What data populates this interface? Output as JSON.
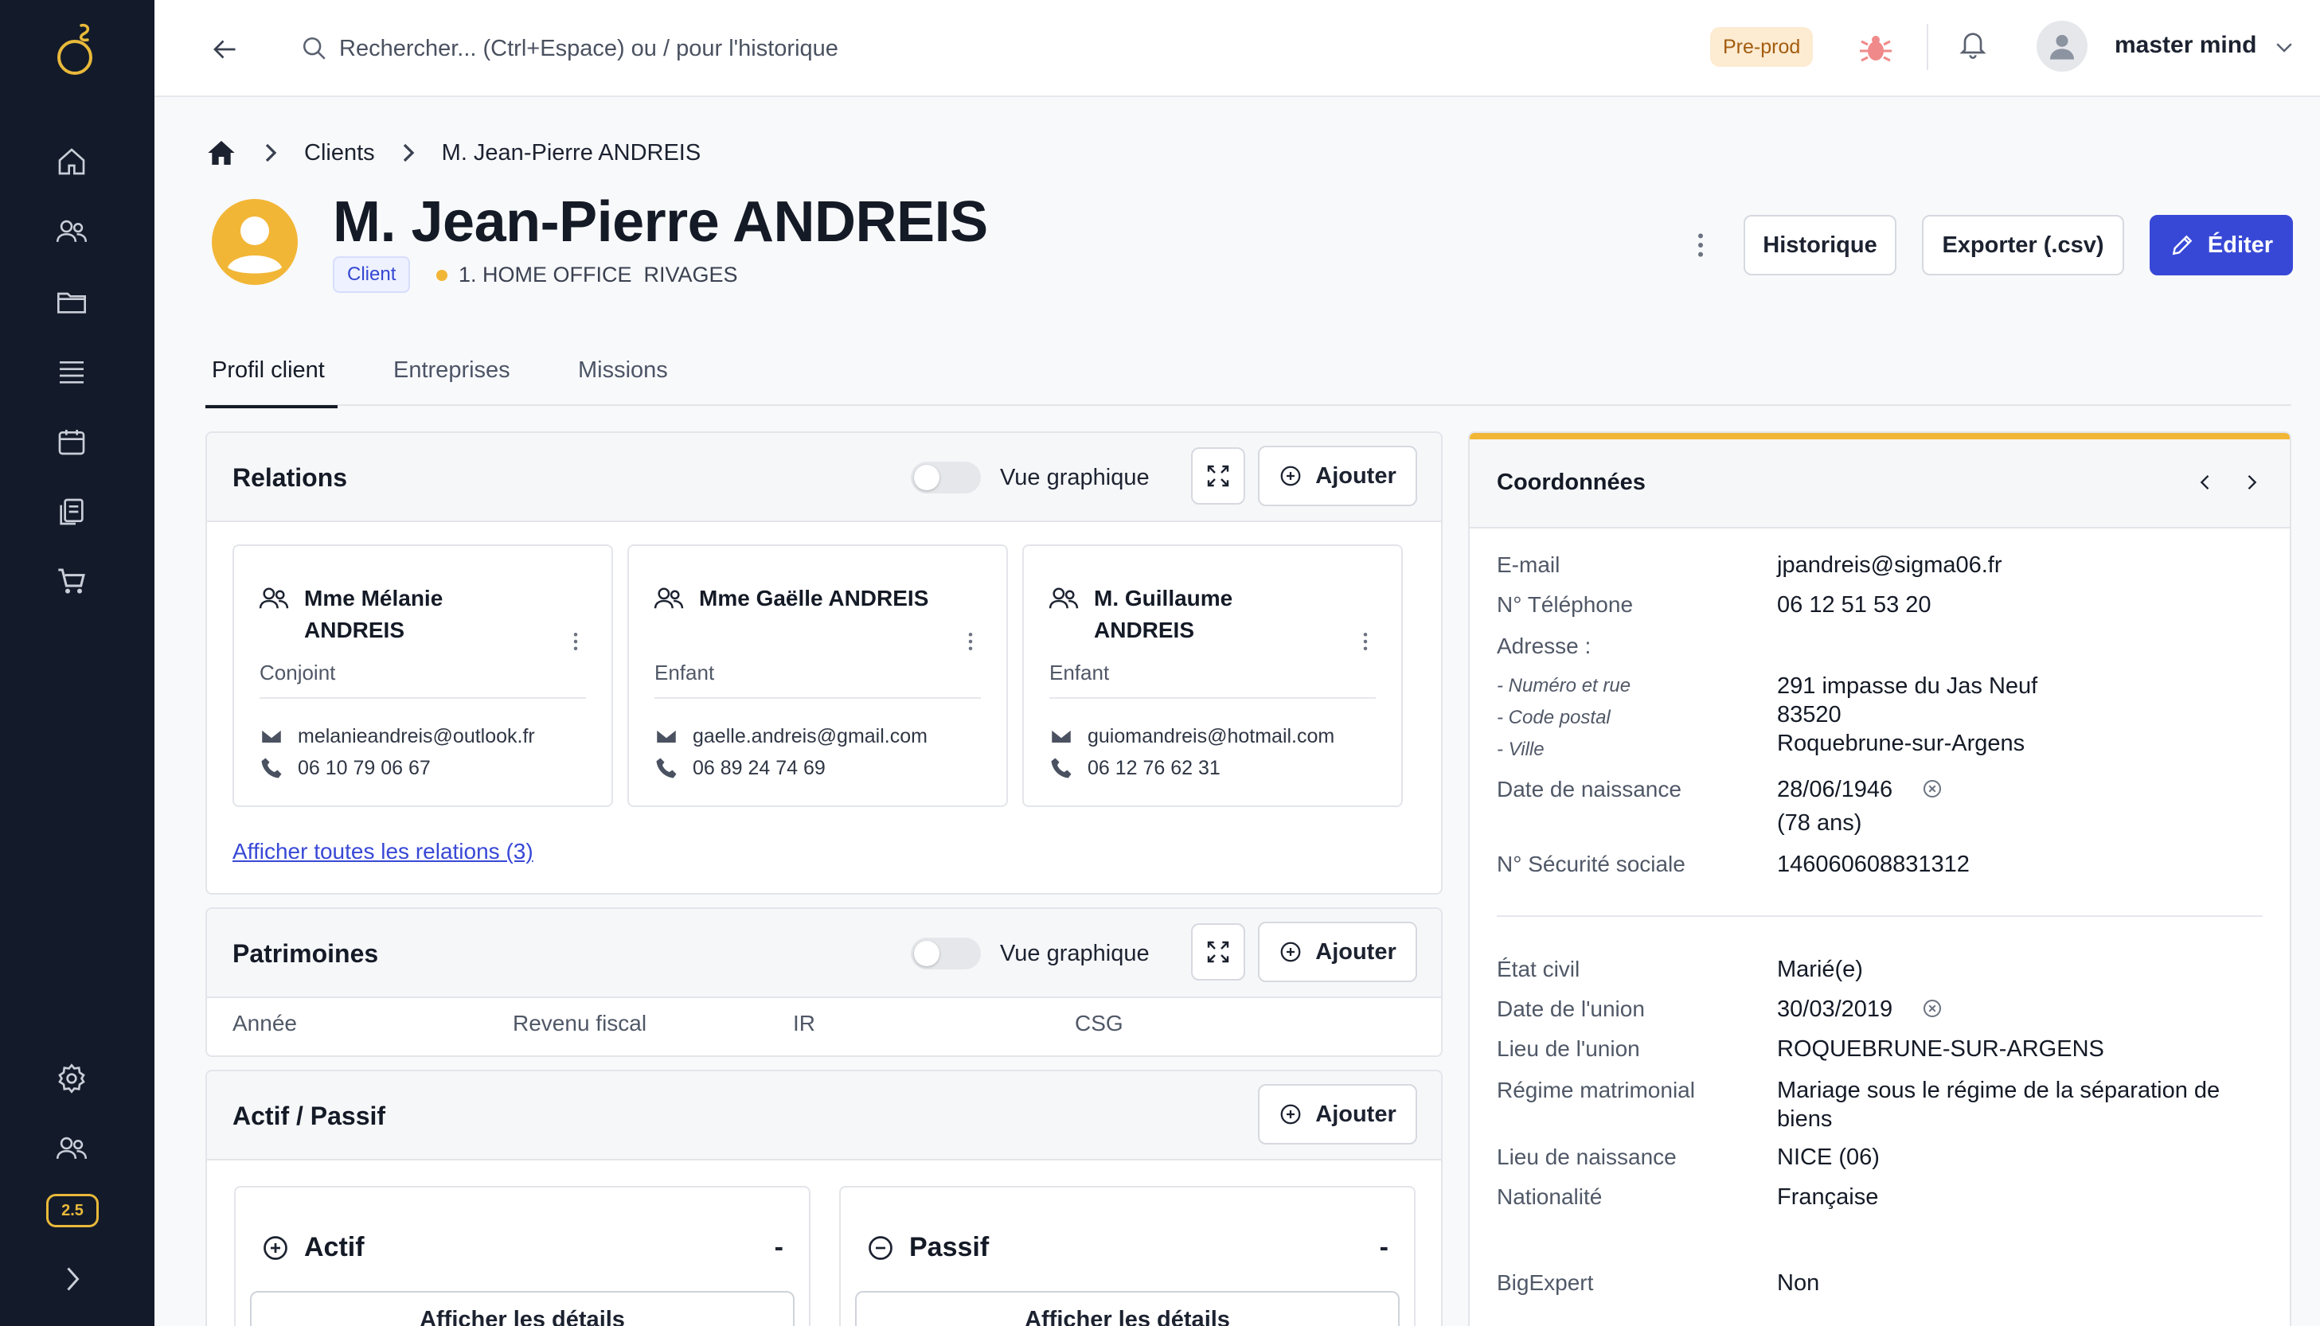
{
  "colors": {
    "sidebar_bg": "#131a2a",
    "primary": "#3848d6",
    "accent": "#f2b636",
    "env_badge_bg": "#fdebd2",
    "env_badge_fg": "#a35d0f"
  },
  "sidebar": {
    "logo": "oˢ",
    "items": [
      {
        "icon": "home-icon"
      },
      {
        "icon": "users-icon"
      },
      {
        "icon": "folder-icon"
      },
      {
        "icon": "list-icon"
      },
      {
        "icon": "calendar-icon"
      },
      {
        "icon": "documents-icon"
      },
      {
        "icon": "cart-icon"
      },
      {
        "icon": "settings-icon"
      },
      {
        "icon": "team-icon"
      }
    ],
    "version": "2.5",
    "expand_icon": "chevron-right-icon"
  },
  "topbar": {
    "search_placeholder": "Rechercher... (Ctrl+Espace) ou / pour l'historique",
    "env_badge": "Pre-prod",
    "user_name": "master mind"
  },
  "breadcrumb": {
    "items": [
      "Clients",
      "M. Jean-Pierre ANDREIS"
    ]
  },
  "client": {
    "name": "M. Jean-Pierre ANDREIS",
    "badge": "Client",
    "org": "1. HOME OFFICE  RIVAGES"
  },
  "actions": {
    "history": "Historique",
    "export": "Exporter (.csv)",
    "edit": "Éditer"
  },
  "tabs": [
    "Profil client",
    "Entreprises",
    "Missions"
  ],
  "relations": {
    "title": "Relations",
    "toggle_label": "Vue graphique",
    "add_label": "Ajouter",
    "cards": [
      {
        "name": "Mme Mélanie ANDREIS",
        "role": "Conjoint",
        "email": "melanieandreis@outlook.fr",
        "phone": "06 10 79 06 67"
      },
      {
        "name": "Mme Gaëlle ANDREIS",
        "role": "Enfant",
        "email": "gaelle.andreis@gmail.com",
        "phone": "06 89 24 74 69"
      },
      {
        "name": "M. Guillaume ANDREIS",
        "role": "Enfant",
        "email": "guiomandreis@hotmail.com",
        "phone": "06 12 76 62 31"
      }
    ],
    "show_all": "Afficher toutes les relations (3)"
  },
  "patrimoines": {
    "title": "Patrimoines",
    "toggle_label": "Vue graphique",
    "add_label": "Ajouter",
    "columns": [
      "Année",
      "Revenu fiscal",
      "IR",
      "CSG"
    ]
  },
  "actif_passif": {
    "title": "Actif / Passif",
    "add_label": "Ajouter",
    "actif": {
      "title": "Actif",
      "value": "-",
      "button": "Afficher les détails"
    },
    "passif": {
      "title": "Passif",
      "value": "-",
      "button": "Afficher les détails"
    }
  },
  "coordonnees": {
    "title": "Coordonnées",
    "email_label": "E-mail",
    "email": "jpandreis@sigma06.fr",
    "phone_label": "N° Téléphone",
    "phone": "06 12 51 53 20",
    "address_label": "Adresse :",
    "street_label": "- Numéro et rue",
    "street": "291 impasse du Jas Neuf",
    "postal_label": "- Code postal",
    "postal": "83520",
    "city_label": "- Ville",
    "city": "Roquebrune-sur-Argens",
    "birth_label": "Date de naissance",
    "birth": "28/06/1946",
    "age": "(78 ans)",
    "ssn_label": "N° Sécurité sociale",
    "ssn": "146060608831312",
    "civil_label": "État civil",
    "civil": "Marié(e)",
    "union_date_label": "Date de l'union",
    "union_date": "30/03/2019",
    "union_place_label": "Lieu de l'union",
    "union_place": "ROQUEBRUNE-SUR-ARGENS",
    "regime_label": "Régime matrimonial",
    "regime": "Mariage sous le régime de la séparation de biens",
    "birthplace_label": "Lieu de naissance",
    "birthplace": "NICE (06)",
    "nationality_label": "Nationalité",
    "nationality": "Française",
    "bigexpert_label": "BigExpert",
    "bigexpert": "Non"
  }
}
